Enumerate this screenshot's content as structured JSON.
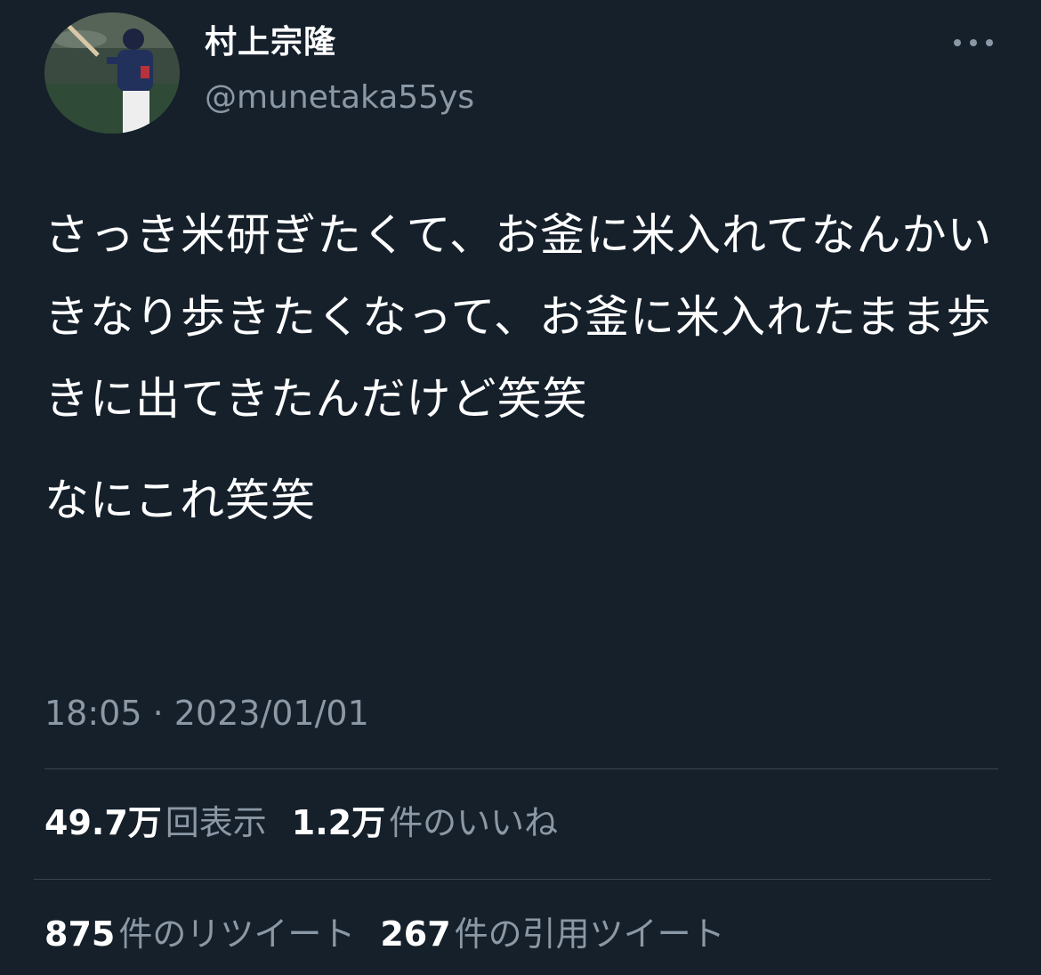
{
  "author": {
    "display_name": "村上宗隆",
    "handle": "@munetaka55ys"
  },
  "icons": {
    "avatar": "avatar-photo-baseball-player",
    "more": "more-horizontal-icon"
  },
  "tweet": {
    "text": "さっき米研ぎたくて、お釜に米入れてなんかいきなり歩きたくなって、お釜に米入れたまま歩きに出てきたんだけど笑笑",
    "text_second": "なにこれ笑笑",
    "timestamp": "18:05 · 2023/01/01"
  },
  "stats": {
    "views_count": "49.7万",
    "views_label": "回表示",
    "likes_count": "1.2万",
    "likes_label": "件のいいね",
    "retweets_count": "875",
    "retweets_label": "件のリツイート",
    "quotes_count": "267",
    "quotes_label": "件の引用ツイート"
  },
  "colors": {
    "background": "#15202b",
    "primary_text": "#ffffff",
    "secondary_text": "#8b98a5",
    "divider": "#38444d"
  }
}
